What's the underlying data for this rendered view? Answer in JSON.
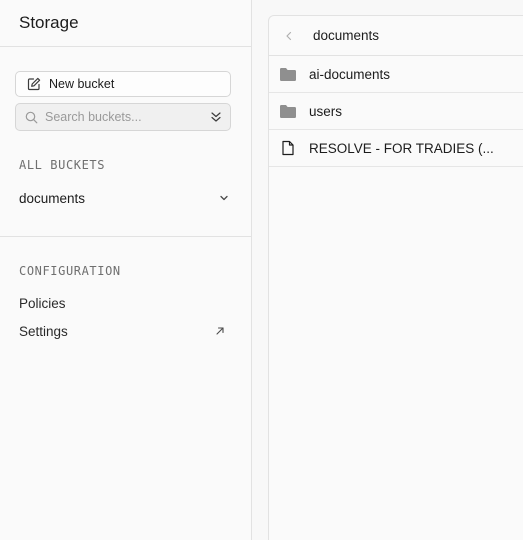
{
  "sidebar": {
    "title": "Storage",
    "new_bucket_label": "New bucket",
    "search": {
      "placeholder": "Search buckets...",
      "value": ""
    },
    "all_buckets_label": "ALL BUCKETS",
    "buckets": [
      {
        "label": "documents"
      }
    ],
    "configuration_label": "CONFIGURATION",
    "config_items": [
      {
        "label": "Policies"
      },
      {
        "label": "Settings"
      }
    ]
  },
  "explorer": {
    "column_title": "documents",
    "items": [
      {
        "type": "folder",
        "name": "ai-documents"
      },
      {
        "type": "folder",
        "name": "users"
      },
      {
        "type": "file",
        "name": "RESOLVE - FOR TRADIES (..."
      }
    ]
  },
  "colors": {
    "folder": "#8f8f8f",
    "border": "#e2e2e2",
    "muted_text": "#6f6f6f"
  }
}
